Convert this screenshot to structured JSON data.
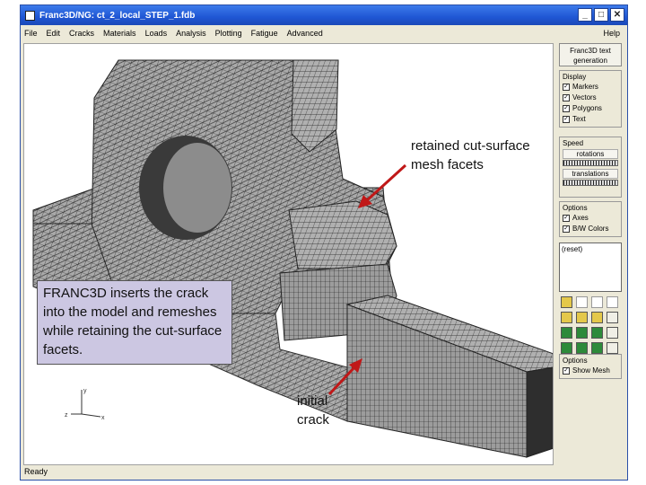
{
  "window": {
    "title": "Franc3D/NG:  ct_2_local_STEP_1.fdb"
  },
  "menu": {
    "items": [
      "File",
      "Edit",
      "Cracks",
      "Materials",
      "Loads",
      "Analysis",
      "Plotting",
      "Fatigue",
      "Advanced"
    ],
    "help": "Help"
  },
  "panel": {
    "text_gen_button": "Franc3D text generation",
    "display": {
      "label": "Display",
      "items": [
        "Markers",
        "Vectors",
        "Polygons",
        "Text"
      ]
    },
    "speed": {
      "label": "Speed",
      "rotations": "rotations",
      "translations": "translations"
    },
    "options1": {
      "label": "Options",
      "items": [
        "Axes",
        "B/W Colors"
      ]
    },
    "listbox": "(reset)",
    "options2": {
      "label": "Options",
      "items": [
        "Show Mesh"
      ]
    }
  },
  "status": "Ready",
  "annotations": {
    "callout": "FRANC3D inserts the crack into the model and remeshes while retaining the cut-surface facets.",
    "retained": "retained cut-surface mesh facets",
    "initial": "initial crack"
  },
  "colors": {
    "mesh_fill": "#a9a9a9",
    "mesh_line": "#1a1a1a",
    "arrow": "#c01818",
    "callout_bg": "#ccc7e2"
  }
}
